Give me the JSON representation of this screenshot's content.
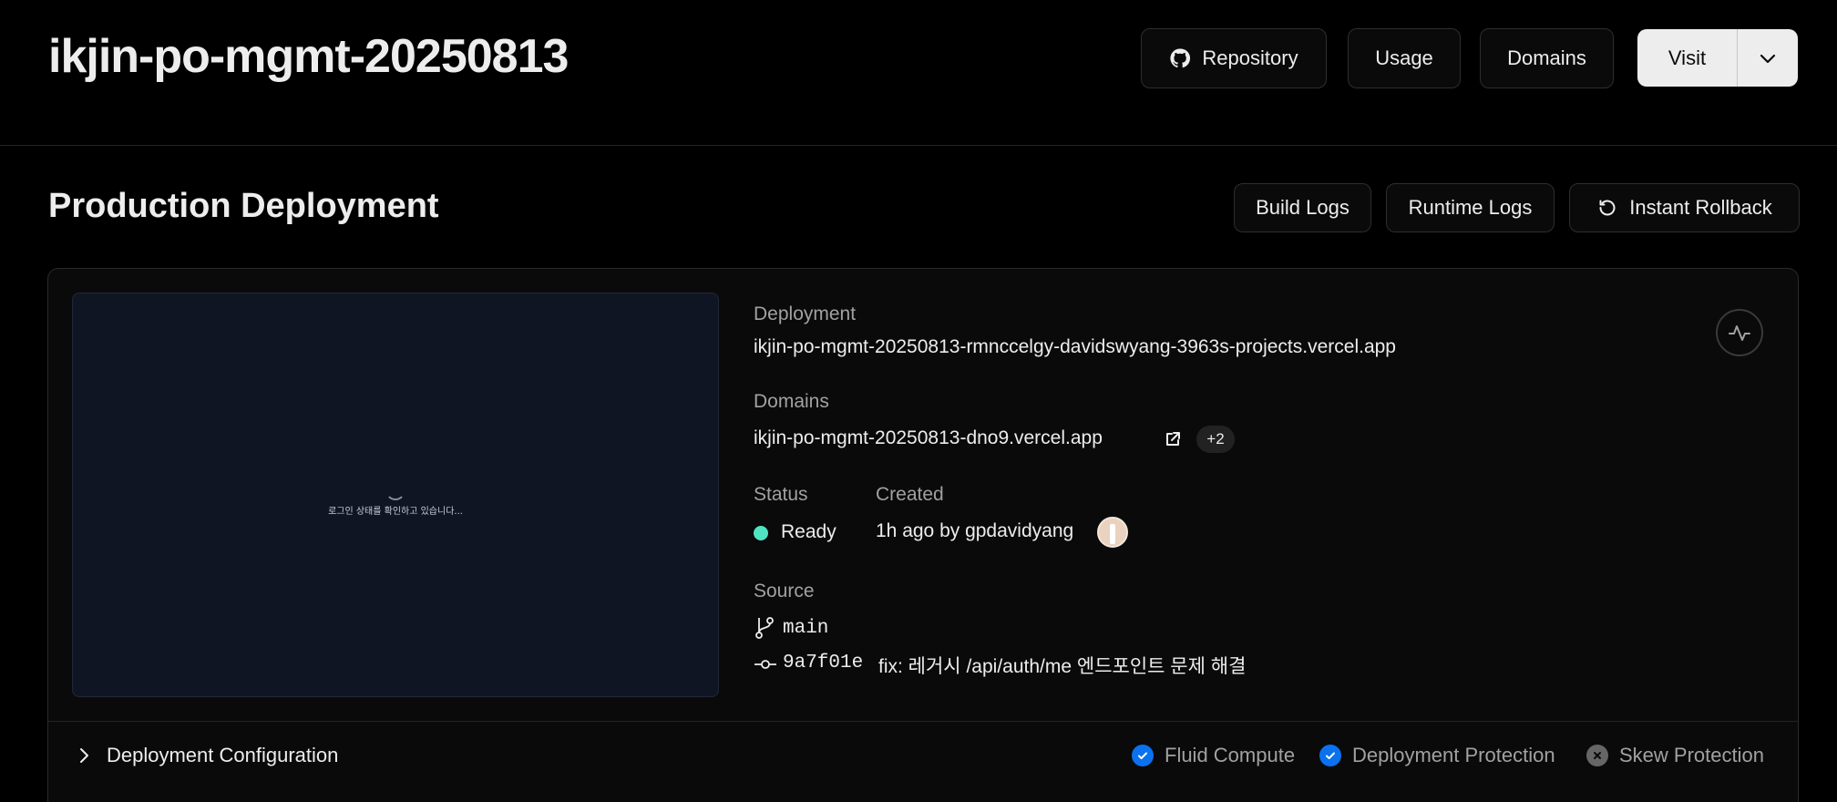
{
  "header": {
    "project_name": "ikjin-po-mgmt-20250813",
    "repository_label": "Repository",
    "usage_label": "Usage",
    "domains_label": "Domains",
    "visit_label": "Visit"
  },
  "section": {
    "title": "Production Deployment",
    "build_logs_label": "Build Logs",
    "runtime_logs_label": "Runtime Logs",
    "rollback_label": "Instant Rollback"
  },
  "preview": {
    "loading_text": "로그인 상태를 확인하고 있습니다..."
  },
  "deployment": {
    "label": "Deployment",
    "url": "ikjin-po-mgmt-20250813-rmnccelgy-davidswyang-3963s-projects.vercel.app"
  },
  "domains": {
    "label": "Domains",
    "primary": "ikjin-po-mgmt-20250813-dno9.vercel.app",
    "more_count": "+2"
  },
  "status": {
    "label": "Status",
    "value": "Ready",
    "color": "#50e3c2"
  },
  "created": {
    "label": "Created",
    "value": "1h ago by gpdavidyang"
  },
  "source": {
    "label": "Source",
    "branch": "main",
    "commit_hash": "9a7f01e",
    "commit_message": "fix: 레거시 /api/auth/me 엔드포인트 문제 해결"
  },
  "config": {
    "label": "Deployment Configuration",
    "features": [
      {
        "name": "Fluid Compute",
        "enabled": true
      },
      {
        "name": "Deployment Protection",
        "enabled": true
      },
      {
        "name": "Skew Protection",
        "enabled": false
      }
    ]
  },
  "colors": {
    "accent_blue": "#0a72ef",
    "ready_green": "#50e3c2"
  }
}
